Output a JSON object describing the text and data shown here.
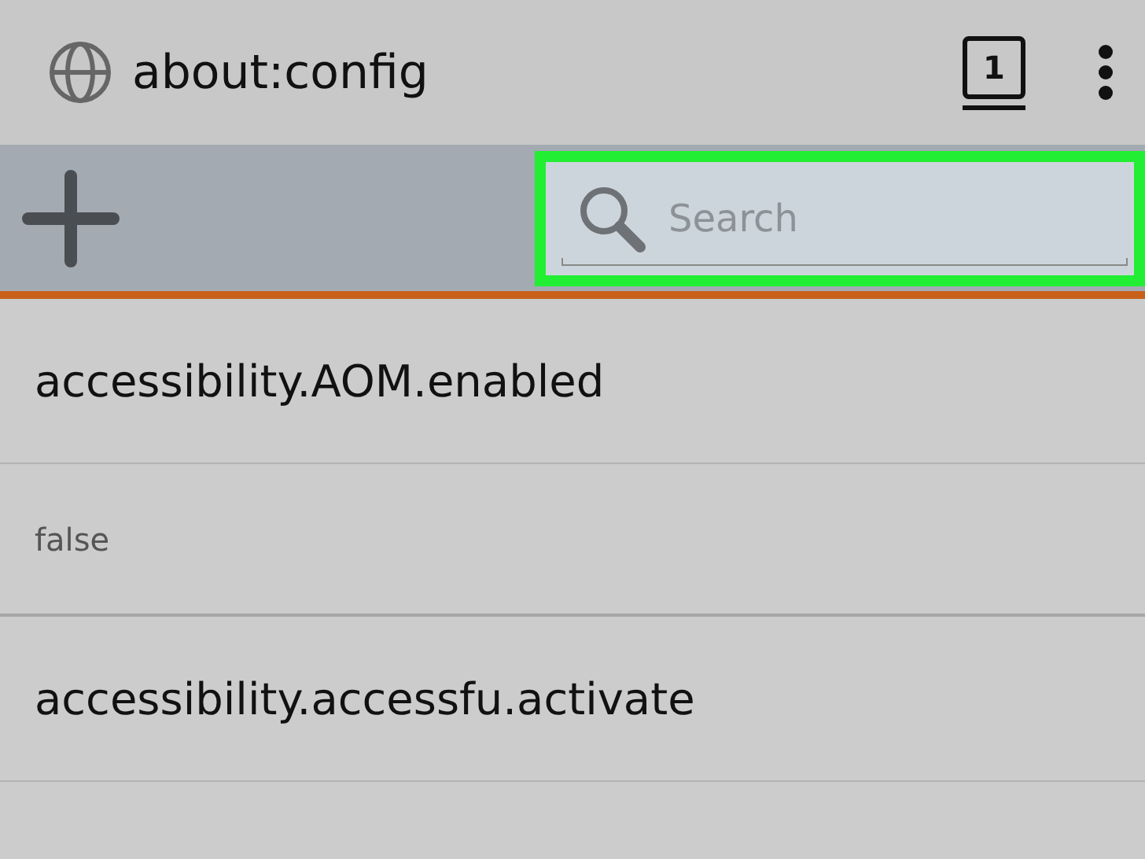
{
  "address_bar": {
    "url": "about:config",
    "tab_count": "1"
  },
  "toolbar": {
    "search": {
      "placeholder": "Search",
      "highlighted": true
    }
  },
  "preferences": [
    {
      "name": "accessibility.AOM.enabled",
      "value": "false"
    },
    {
      "name": "accessibility.accessfu.activate"
    }
  ]
}
